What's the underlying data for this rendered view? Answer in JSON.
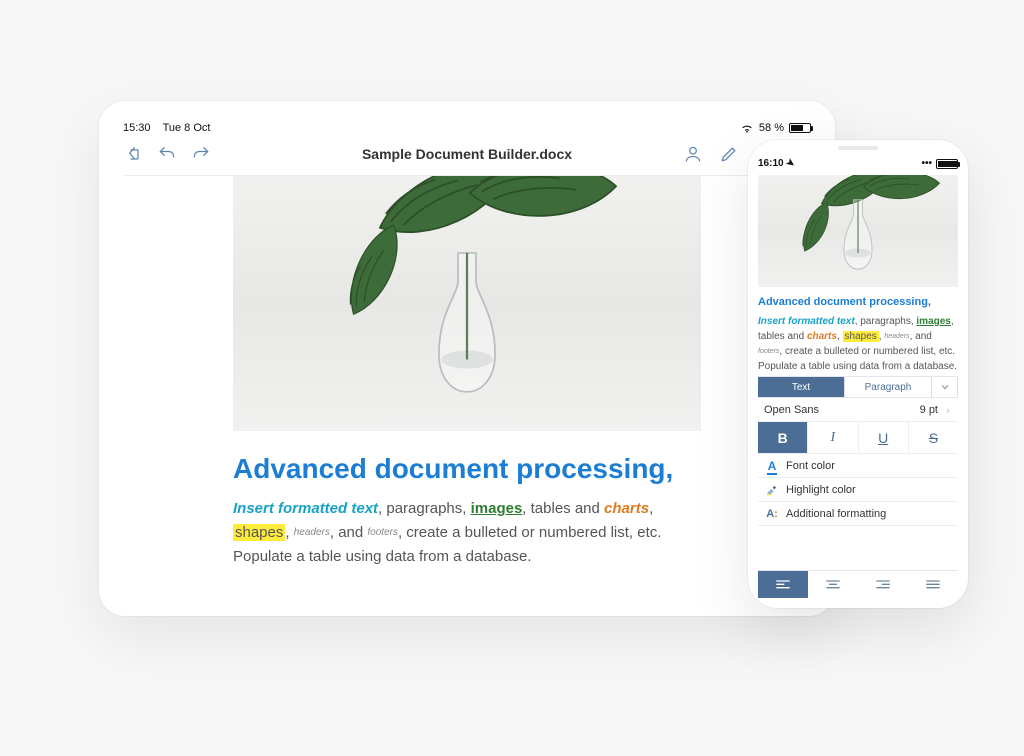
{
  "colors": {
    "accent_blue": "#1c7dd4",
    "toolbar_blue": "#4c6e96",
    "highlight_yellow": "#ffeb3b",
    "green": "#2e7d32",
    "orange": "#e07b1f"
  },
  "tablet": {
    "status": {
      "time": "15:30",
      "date": "Tue 8 Oct",
      "battery_pct": "58 %",
      "battery_fill_pct": 58,
      "wifi_icon": "wifi-icon"
    },
    "toolbar": {
      "doc_title": "Sample Document Builder.docx",
      "left_icons": [
        "back-file-icon",
        "undo-icon",
        "redo-icon"
      ],
      "right_icons": [
        "user-icon",
        "edit-icon",
        "plus-icon",
        "search-icon"
      ]
    },
    "document": {
      "heading": "Advanced document processing,",
      "body_parts": {
        "insert_formatted_text": "Insert formatted text",
        "after_ift": ",  paragraphs, ",
        "images": "images",
        "after_images": ", tables and ",
        "charts": "charts",
        "after_charts": ", ",
        "shapes": "shapes",
        "after_shapes": ", ",
        "sup_headers": "headers",
        "and": ", and ",
        "sup_footers": "footers",
        "tail": ", create a bulleted or numbered list, etc. Populate a table using data from a database."
      }
    }
  },
  "phone": {
    "status": {
      "time": "16:10",
      "icons": [
        "location-icon",
        "cell-icon",
        "battery-icon"
      ]
    },
    "document": {
      "heading": "Advanced document processing,",
      "body_parts": {
        "insert_formatted_text": "Insert formatted text",
        "after_ift": ",  paragraphs, ",
        "images": "images",
        "after_images": ", tables and ",
        "charts": "charts",
        "after_charts": ", ",
        "shapes": "shapes",
        "after_shapes": ", ",
        "sup_headers": "headers",
        "and": ", and ",
        "sup_footers": "footers",
        "tail": ", create a bulleted or numbered list, etc. Populate a table using data from a database."
      }
    },
    "segmented": {
      "text_label": "Text",
      "paragraph_label": "Paragraph"
    },
    "font_row": {
      "font_name": "Open Sans",
      "font_size": "9 pt"
    },
    "style_buttons": {
      "bold": "B",
      "italic": "I",
      "underline": "U",
      "strike": "S",
      "active": "bold"
    },
    "options": {
      "font_color": "Font color",
      "highlight_color": "Highlight color",
      "additional_formatting": "Additional formatting"
    },
    "alignment": {
      "options": [
        "left",
        "center",
        "right",
        "justify"
      ],
      "active": "left"
    }
  }
}
